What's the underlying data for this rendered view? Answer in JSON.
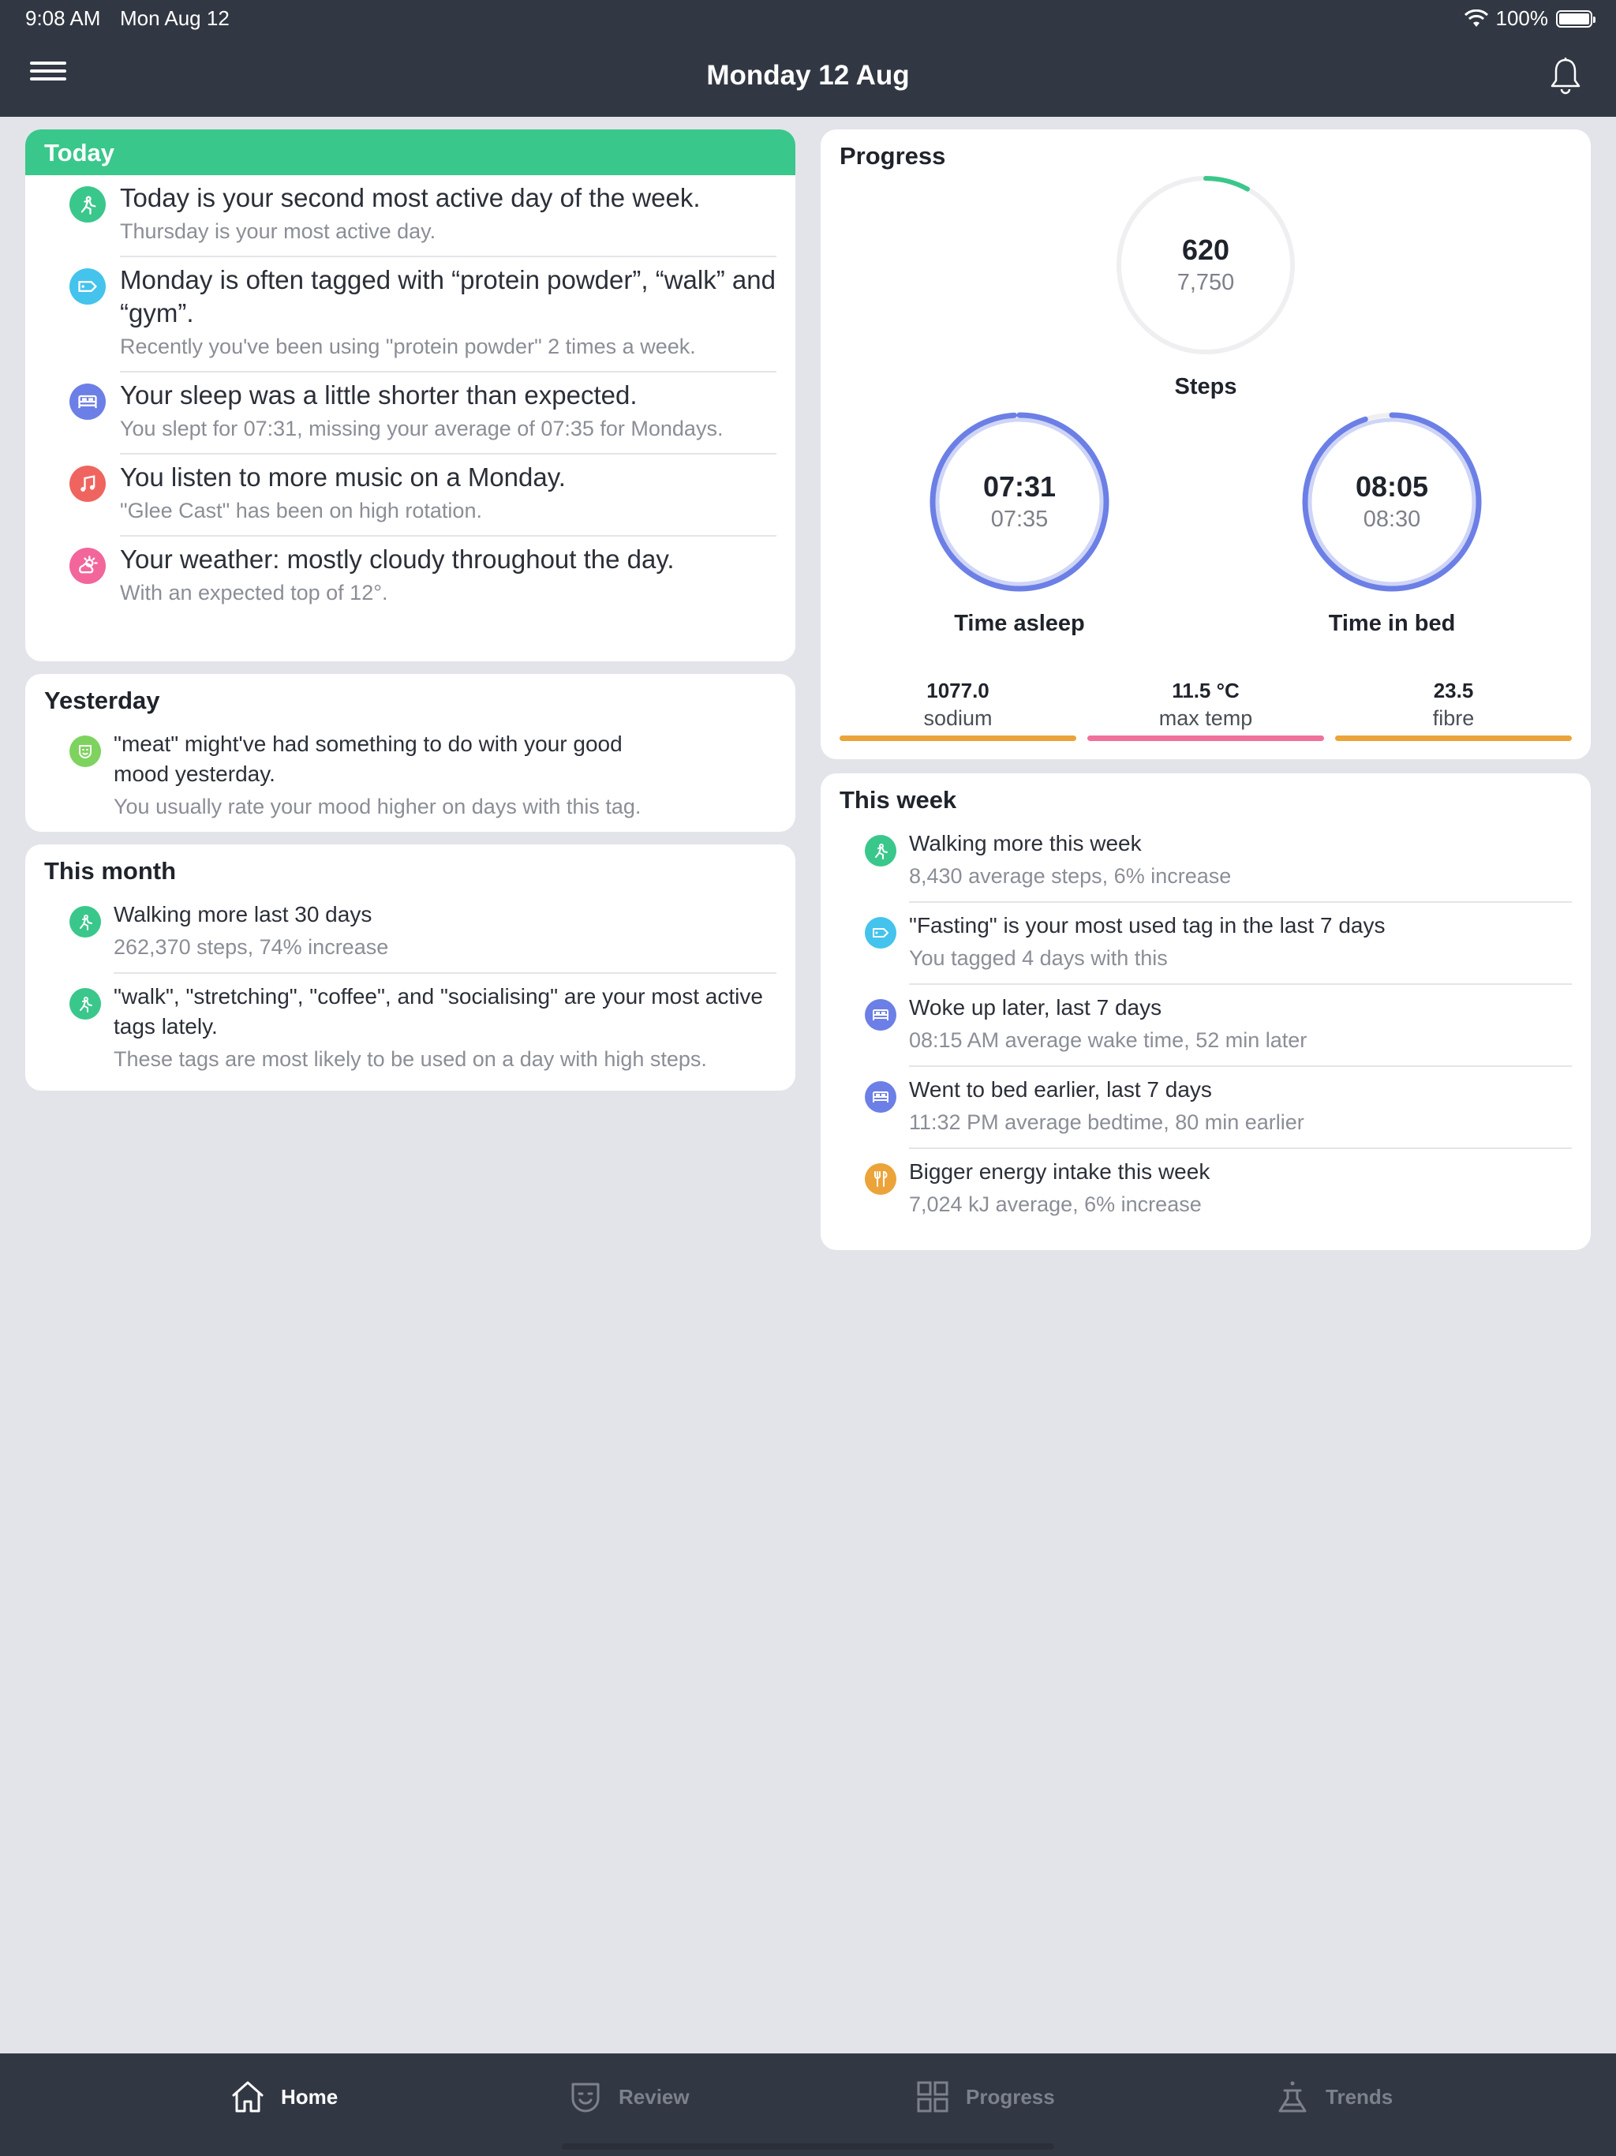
{
  "status_bar": {
    "time": "9:08 AM",
    "date": "Mon Aug 12",
    "battery": "100%"
  },
  "header": {
    "title": "Monday 12 Aug"
  },
  "today": {
    "title": "Today",
    "items": [
      {
        "icon": "walking-icon",
        "color": "#3ac78b",
        "main": "Today is your second most active day of the week.",
        "sub": "Thursday is your most active day."
      },
      {
        "icon": "tag-icon",
        "color": "#44c3ec",
        "main": "Monday is often tagged with “protein powder”, “walk” and “gym”.",
        "sub": "Recently you've been using \"protein powder\" 2 times a week."
      },
      {
        "icon": "bed-icon",
        "color": "#6c7fe6",
        "main": "Your sleep was a little shorter than expected.",
        "sub": "You slept for 07:31, missing your average of 07:35 for Mondays."
      },
      {
        "icon": "music-icon",
        "color": "#f0645f",
        "main": "You listen to more music on a Monday.",
        "sub": "\"Glee Cast\" has been on high rotation."
      },
      {
        "icon": "weather-icon",
        "color": "#f2669b",
        "main": "Your weather: mostly cloudy throughout the day.",
        "sub": "With an expected top of 12°."
      }
    ]
  },
  "yesterday": {
    "title": "Yesterday",
    "items": [
      {
        "icon": "mood-icon",
        "color": "#7ed35f",
        "main": "\"meat\" might've had something to do with your good mood yesterday.",
        "sub": "You usually rate your mood higher on days with this tag."
      }
    ]
  },
  "this_month": {
    "title": "This month",
    "items": [
      {
        "icon": "walking-icon",
        "color": "#3ac78b",
        "main": "Walking more last 30 days",
        "sub": "262,370 steps, 74% increase"
      },
      {
        "icon": "walking-icon",
        "color": "#3ac78b",
        "main": "\"walk\", \"stretching\", \"coffee\", and \"socialising\" are your most active tags lately.",
        "sub": "These tags are most likely to be used on a day with high steps."
      }
    ]
  },
  "progress": {
    "title": "Progress",
    "steps": {
      "value": "620",
      "target": "7,750",
      "label": "Steps",
      "fraction": 0.08,
      "color": "#3ac78b"
    },
    "asleep": {
      "value": "07:31",
      "target": "07:35",
      "label": "Time asleep",
      "fraction": 0.99,
      "color": "#6c7fe6"
    },
    "inbed": {
      "value": "08:05",
      "target": "08:30",
      "label": "Time in bed",
      "fraction": 0.95,
      "color": "#6c7fe6"
    },
    "stats": [
      {
        "value": "1077.0",
        "name": "sodium",
        "color": "#eba33a"
      },
      {
        "value": "11.5 °C",
        "name": "max temp",
        "color": "#f0719c"
      },
      {
        "value": "23.5",
        "name": "fibre",
        "color": "#eba33a"
      }
    ]
  },
  "this_week": {
    "title": "This week",
    "items": [
      {
        "icon": "walking-icon",
        "color": "#3ac78b",
        "main": "Walking more this week",
        "sub": "8,430 average steps, 6% increase"
      },
      {
        "icon": "tag-icon",
        "color": "#44c3ec",
        "main": "\"Fasting\" is your most used tag in the last 7 days",
        "sub": "You tagged 4 days with this"
      },
      {
        "icon": "bed-icon",
        "color": "#6c7fe6",
        "main": "Woke up later, last 7 days",
        "sub": "08:15 AM average wake time, 52 min later"
      },
      {
        "icon": "bed-icon",
        "color": "#6c7fe6",
        "main": "Went to bed earlier, last 7 days",
        "sub": "11:32 PM average bedtime, 80 min earlier"
      },
      {
        "icon": "food-icon",
        "color": "#eba33a",
        "main": "Bigger energy intake this week",
        "sub": "7,024 kJ average, 6% increase"
      }
    ]
  },
  "tabbar": {
    "tabs": [
      {
        "label": "Home",
        "icon": "home-icon",
        "active": true
      },
      {
        "label": "Review",
        "icon": "mood-icon",
        "active": false
      },
      {
        "label": "Progress",
        "icon": "grid-icon",
        "active": false
      },
      {
        "label": "Trends",
        "icon": "flask-icon",
        "active": false
      }
    ]
  }
}
